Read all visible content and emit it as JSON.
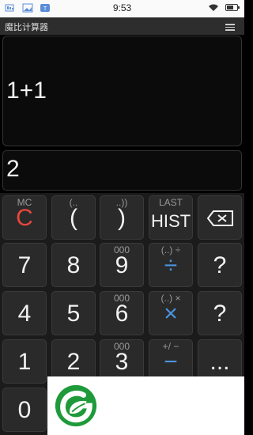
{
  "status_bar": {
    "time": "9:53",
    "left_icons": [
      "sim-icon",
      "image-icon",
      "notification-icon"
    ],
    "right_icons": [
      "wifi-icon",
      "battery-icon"
    ]
  },
  "app": {
    "title": "魔比计算器",
    "menu_icon": "menu-icon"
  },
  "display": {
    "expression": "1+1",
    "result": "2"
  },
  "keys": {
    "row1": [
      {
        "sub": "MC",
        "main": "C"
      },
      {
        "sub": "(..",
        "main": "("
      },
      {
        "sub": "..))",
        "main": ")"
      },
      {
        "sub": "LAST",
        "main": "HIST"
      },
      {
        "sub": "",
        "main": "",
        "icon": "backspace-icon"
      }
    ],
    "row2": [
      {
        "sub": "",
        "main": "7"
      },
      {
        "sub": "",
        "main": "8"
      },
      {
        "sub": "000",
        "main": "9"
      },
      {
        "sub": "(..) ÷",
        "main": "÷"
      },
      {
        "sub": "",
        "main": "?"
      }
    ],
    "row3": [
      {
        "sub": "",
        "main": "4"
      },
      {
        "sub": "",
        "main": "5"
      },
      {
        "sub": "000",
        "main": "6"
      },
      {
        "sub": "(..) ×",
        "main": "×"
      },
      {
        "sub": "",
        "main": "?"
      }
    ],
    "row4": [
      {
        "sub": "",
        "main": "1"
      },
      {
        "sub": "",
        "main": "2"
      },
      {
        "sub": "000",
        "main": "3"
      },
      {
        "sub": "+/ −",
        "main": "−"
      },
      {
        "sub": "",
        "main": "..."
      }
    ],
    "row5": [
      {
        "sub": "",
        "main": "0"
      }
    ]
  },
  "colors": {
    "clear_key": "#e6473f",
    "operator_key": "#4a94e0",
    "logo_green": "#1f9a3a"
  },
  "overlay": {
    "logo_icon": "leaf-logo-icon"
  }
}
